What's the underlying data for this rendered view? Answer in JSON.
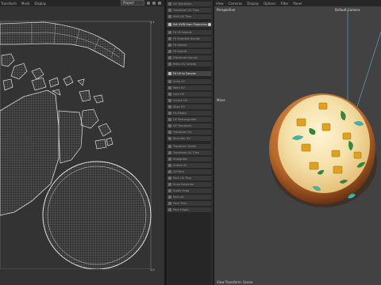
{
  "uv_editor": {
    "menu": [
      "Transform",
      "Mesh",
      "Display"
    ],
    "mode_select": "Project",
    "coord_top_right": "1,1",
    "coord_bottom_right": "1,0"
  },
  "command_panel": {
    "items": [
      {
        "label": "UV Transform",
        "highlight": false
      },
      {
        "label": "Transform UV Tiles",
        "highlight": false
      },
      {
        "label": "Shift UV Tiles",
        "highlight": false
      },
      {
        "label": "Set UVW from Projection",
        "highlight": true
      },
      {
        "label": "Fit UV Islands",
        "highlight": false
      },
      {
        "label": "Fit Selected Islands",
        "highlight": false
      },
      {
        "label": "Fit Islands",
        "highlight": false
      },
      {
        "label": "Fit Islands",
        "highlight": false
      },
      {
        "label": "Distribute Islands",
        "highlight": false
      },
      {
        "label": "Relax UV Islands",
        "highlight": false
      },
      {
        "label": "Fit UV to Canvas",
        "highlight": true
      },
      {
        "label": "Snap UV",
        "highlight": false
      },
      {
        "label": "Weld UV",
        "highlight": false
      },
      {
        "label": "Lock UV",
        "highlight": false
      },
      {
        "label": "Unlock UV",
        "highlight": false
      },
      {
        "label": "Align UV",
        "highlight": false
      },
      {
        "label": "Fix Edges",
        "highlight": false
      },
      {
        "label": "UV Rectangulate",
        "highlight": false
      },
      {
        "label": "UV Transform",
        "highlight": false
      },
      {
        "label": "Transform UV",
        "highlight": false
      },
      {
        "label": "Recenter UV",
        "highlight": false
      },
      {
        "label": "Transform Guide",
        "highlight": false
      },
      {
        "label": "Transform UV Tiles",
        "highlight": false
      },
      {
        "label": "Straighten",
        "highlight": false
      },
      {
        "label": "Unfold UV",
        "highlight": false
      },
      {
        "label": "UV Pack",
        "highlight": false
      },
      {
        "label": "Pack UV Tiles",
        "highlight": false
      },
      {
        "label": "Snap Selection",
        "highlight": false
      },
      {
        "label": "Guide Snap",
        "highlight": false
      },
      {
        "label": "Pack All",
        "highlight": false
      },
      {
        "label": "Pack Tiles",
        "highlight": false
      },
      {
        "label": "Pack Edges",
        "highlight": false
      }
    ]
  },
  "viewport": {
    "menu": [
      "View",
      "Cameras",
      "Display",
      "Options",
      "Filter",
      "Panel"
    ],
    "view_label": "Perspective",
    "camera_label": "Default Camera",
    "tool_label": "Move",
    "footer": "View Transform: Scene"
  },
  "colors": {
    "uv_background": "#333333",
    "wire": "#c8c8c8",
    "viewport_background": "#424242",
    "panel_item": "#383838",
    "panel_highlight": "#454545"
  }
}
